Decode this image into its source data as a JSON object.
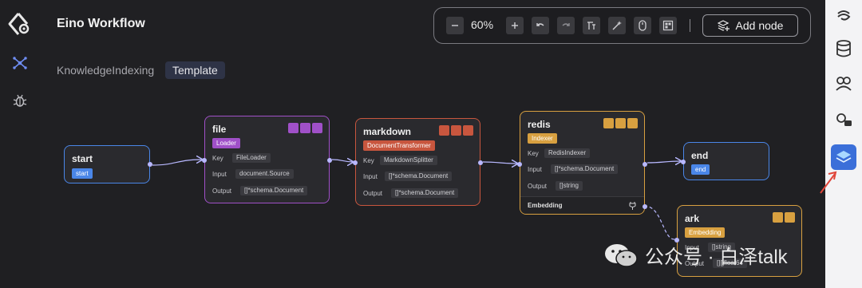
{
  "header": {
    "title": "Eino Workflow"
  },
  "breadcrumb": {
    "graph": "KnowledgeIndexing",
    "tag": "Template"
  },
  "toolbar": {
    "zoom": "60%",
    "add_node": "Add node"
  },
  "nodes": {
    "start": {
      "name": "start",
      "tag": "start"
    },
    "file": {
      "name": "file",
      "tag": "Loader",
      "key_label": "Key",
      "key": "FileLoader",
      "input_label": "Input",
      "input": "document.Source",
      "output_label": "Output",
      "output": "[]*schema.Document"
    },
    "markdown": {
      "name": "markdown",
      "tag": "DocumentTransformer",
      "key_label": "Key",
      "key": "MarkdownSplitter",
      "input_label": "Input",
      "input": "[]*schema.Document",
      "output_label": "Output",
      "output": "[]*schema.Document"
    },
    "redis": {
      "name": "redis",
      "tag": "Indexer",
      "key_label": "Key",
      "key": "RedisIndexer",
      "input_label": "Input",
      "input": "[]*schema.Document",
      "output_label": "Output",
      "output": "[]string",
      "embedding": "Embedding"
    },
    "end": {
      "name": "end",
      "tag": "end"
    },
    "ark": {
      "name": "ark",
      "tag": "Embedding",
      "input_label": "Input",
      "input": "[]string",
      "output_label": "Output",
      "output": "[][]float64"
    }
  },
  "watermark": {
    "text": "公众号 · 白泽talk"
  },
  "colors": {
    "start_end": "#4a86e8",
    "loader": "#a050c8",
    "transformer": "#c8563e",
    "indexer": "#d8a040",
    "accent": "#3b6fd9"
  }
}
